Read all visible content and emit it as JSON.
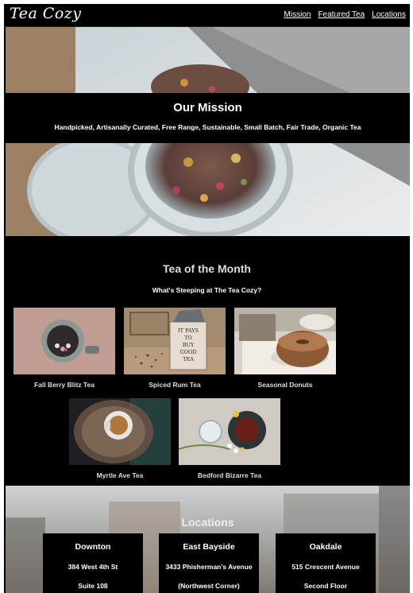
{
  "header": {
    "logo": "Tea Cozy",
    "nav": [
      "Mission",
      "Featured Tea",
      "Locations"
    ]
  },
  "mission": {
    "title": "Our Mission",
    "tagline": "Handpicked, Artisanally Curated, Free Range, Sustainable, Small Batch, Fair Trade, Organic Tea"
  },
  "tea_of_month": {
    "title": "Tea of the Month",
    "subtitle": "What's Steeping at The Tea Cozy?",
    "items": [
      {
        "caption": "Fall Berry Blitz Tea"
      },
      {
        "caption": "Spiced Rum Tea"
      },
      {
        "caption": "Seasonal Donuts"
      },
      {
        "caption": "Myrtle Ave Tea"
      },
      {
        "caption": "Bedford Bizarre Tea"
      }
    ],
    "sign_text": [
      "IT PAYS",
      "TO",
      "BUY",
      "GOOD",
      "TEA"
    ]
  },
  "locations": {
    "title": "Locations",
    "items": [
      {
        "name": "Downton",
        "line1": "384 West 4th St",
        "line2": "Suite 108"
      },
      {
        "name": "East Bayside",
        "line1": "3433 Phisherman's Avenue",
        "line2": "(Northwest Corner)"
      },
      {
        "name": "Oakdale",
        "line1": "515 Crescent Avenue",
        "line2": "Second Floor"
      }
    ]
  }
}
